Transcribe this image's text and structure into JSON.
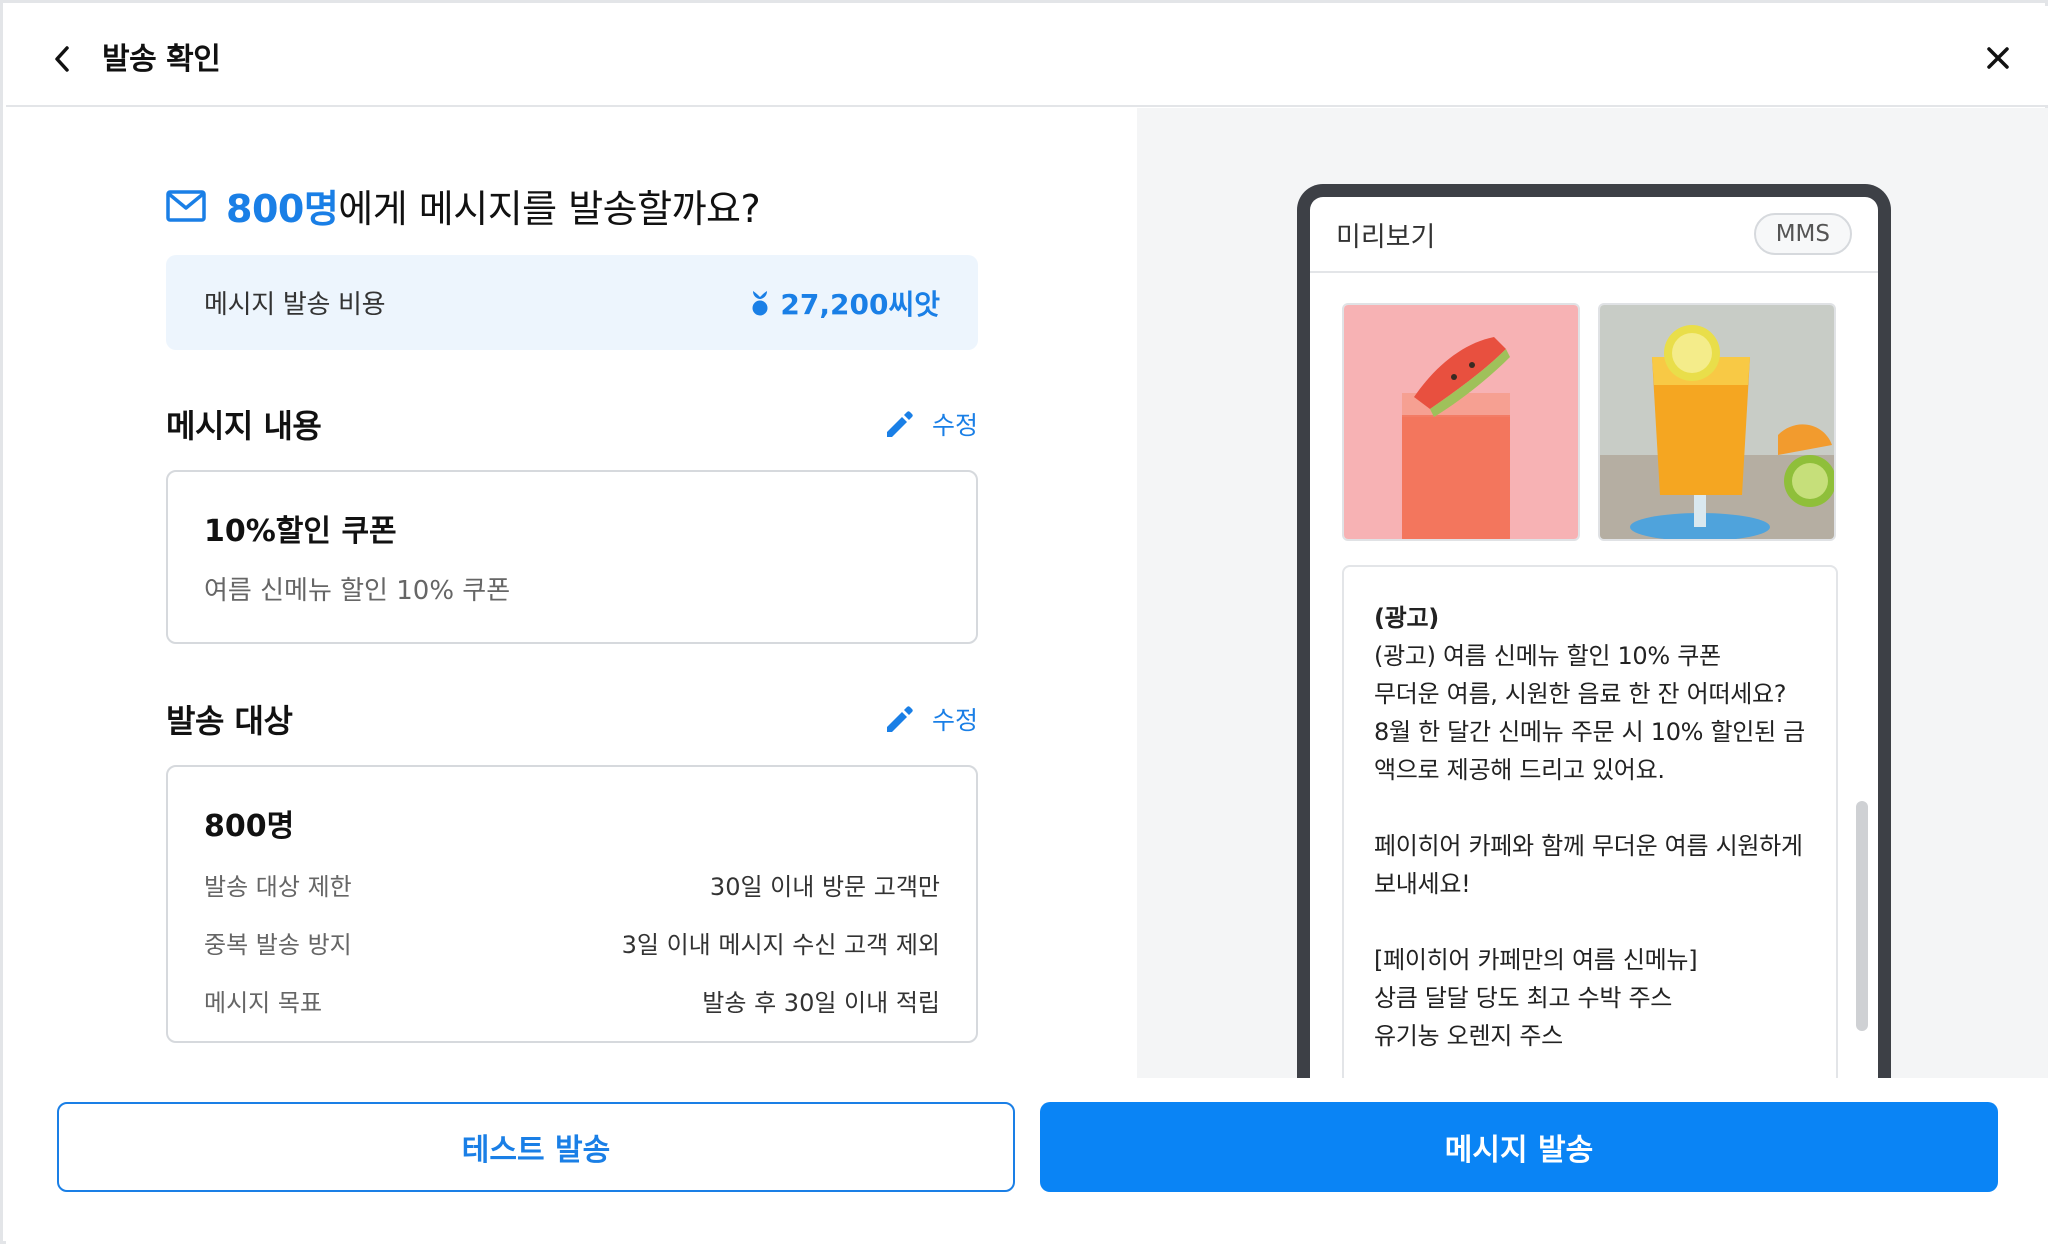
{
  "header": {
    "title": "발송 확인"
  },
  "headline": {
    "count": "800명",
    "rest": "에게 메시지를 발송할까요?"
  },
  "cost": {
    "label": "메시지 발송 비용",
    "value": "27,200씨앗"
  },
  "message_section": {
    "title": "메시지 내용",
    "edit_label": "수정",
    "card_title": "10%할인 쿠폰",
    "card_sub": "여름 신메뉴 할인 10% 쿠폰"
  },
  "target_section": {
    "title": "발송 대상",
    "edit_label": "수정",
    "count": "800명",
    "rows": [
      {
        "key": "발송 대상 제한",
        "value": "30일 이내 방문 고객만"
      },
      {
        "key": "중복 발송 방지",
        "value": "3일 이내 메시지 수신 고객 제외"
      },
      {
        "key": "메시지 목표",
        "value": "발송 후 30일 이내 적립"
      }
    ]
  },
  "preview": {
    "label": "미리보기",
    "badge": "MMS",
    "ad_tag": "(광고)",
    "body": "(광고) 여름 신메뉴 할인 10% 쿠폰\n무더운 여름, 시원한 음료 한 잔 어떠세요?\n8월 한 달간 신메뉴 주문 시 10% 할인된 금\n액으로 제공해 드리고 있어요.\n\n페이히어 카페와 함께 무더운 여름 시원하게\n보내세요!\n\n[페이히어 카페만의 여름 신메뉴]\n상큼 달달 당도 최고 수박 주스\n유기농 오렌지 주스"
  },
  "footer": {
    "test_label": "테스트 발송",
    "send_label": "메시지 발송"
  },
  "colors": {
    "accent": "#1a7fe6",
    "primary_button": "#0a84f5",
    "cost_bg": "#edf5fd",
    "preview_bg": "#f4f5f6",
    "phone_frame": "#3d4046"
  },
  "icons": [
    "chevron-left-icon",
    "close-icon",
    "mail-icon",
    "seed-icon",
    "pencil-icon"
  ]
}
